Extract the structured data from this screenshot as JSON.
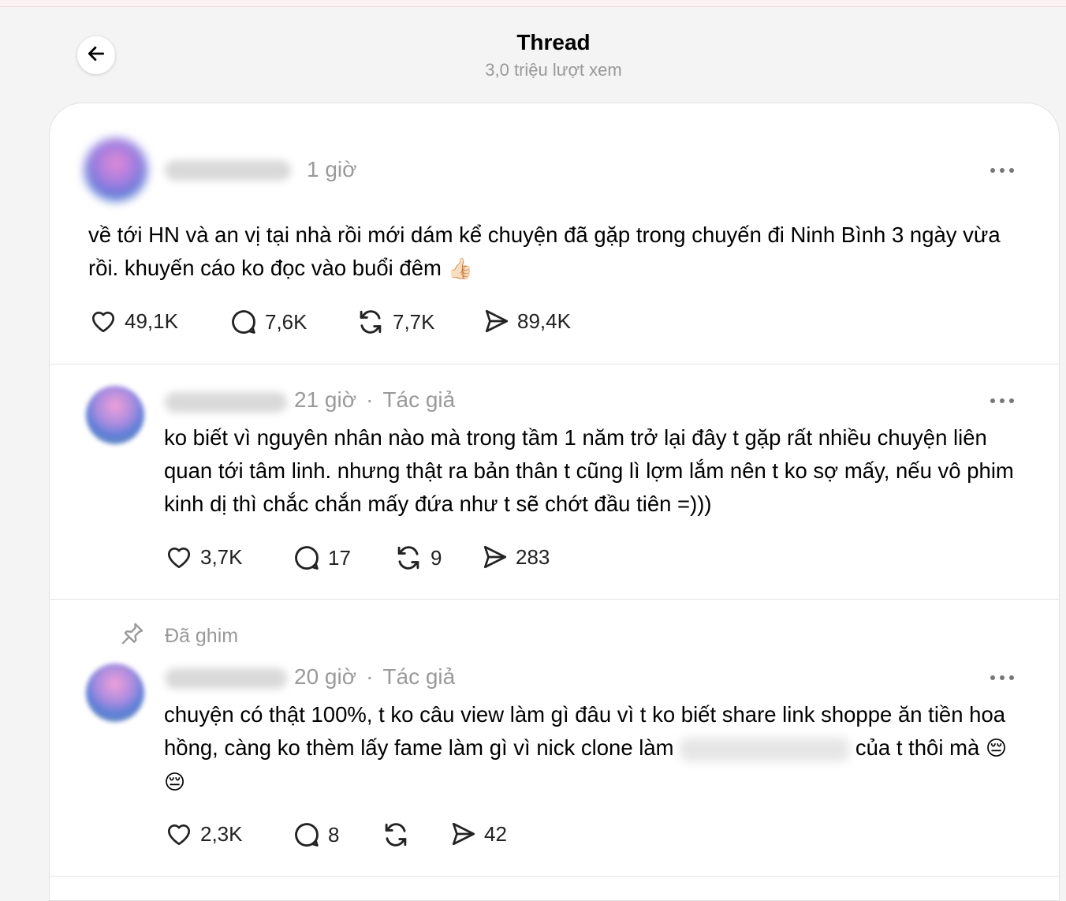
{
  "header": {
    "title": "Thread",
    "subtitle": "3,0 triệu lượt xem"
  },
  "posts": [
    {
      "time": "1 giờ",
      "author_tag": "",
      "text": "về tới HN và an vị tại nhà rồi mới dám kể chuyện đã gặp trong chuyến đi Ninh Bình 3 ngày vừa rồi. khuyến cáo ko đọc vào buổi đêm",
      "emoji": "👍🏻",
      "likes": "49,1K",
      "replies": "7,6K",
      "reposts": "7,7K",
      "shares": "89,4K"
    },
    {
      "time": "21 giờ",
      "dot": "·",
      "author_tag": "Tác giả",
      "text": "ko biết vì nguyên nhân nào mà trong tầm 1 năm trở lại đây t gặp rất nhiều chuyện liên quan tới tâm linh. nhưng thật ra bản thân t cũng lì lợm lắm nên t ko sợ mấy, nếu vô phim kinh dị thì chắc chắn mấy đứa như t sẽ chớt đầu tiên =)))",
      "likes": "3,7K",
      "replies": "17",
      "reposts": "9",
      "shares": "283"
    },
    {
      "pinned_label": "Đã ghim",
      "time": "20 giờ",
      "dot": "·",
      "author_tag": "Tác giả",
      "text_a": "chuyện có thật 100%, t ko câu view làm gì đâu vì t ko biết share link shoppe ăn tiền hoa hồng, càng ko thèm lấy fame làm gì vì nick clone làm",
      "text_b": "của t thôi mà",
      "emoji": "😔😔",
      "likes": "2,3K",
      "replies": "8",
      "reposts": "",
      "shares": "42"
    }
  ],
  "icons": {
    "back": "arrow-left-icon",
    "more": "more-horizontal-icon",
    "like": "heart-icon",
    "reply": "comment-icon",
    "repost": "repost-icon",
    "share": "send-icon",
    "pin": "pin-icon"
  }
}
